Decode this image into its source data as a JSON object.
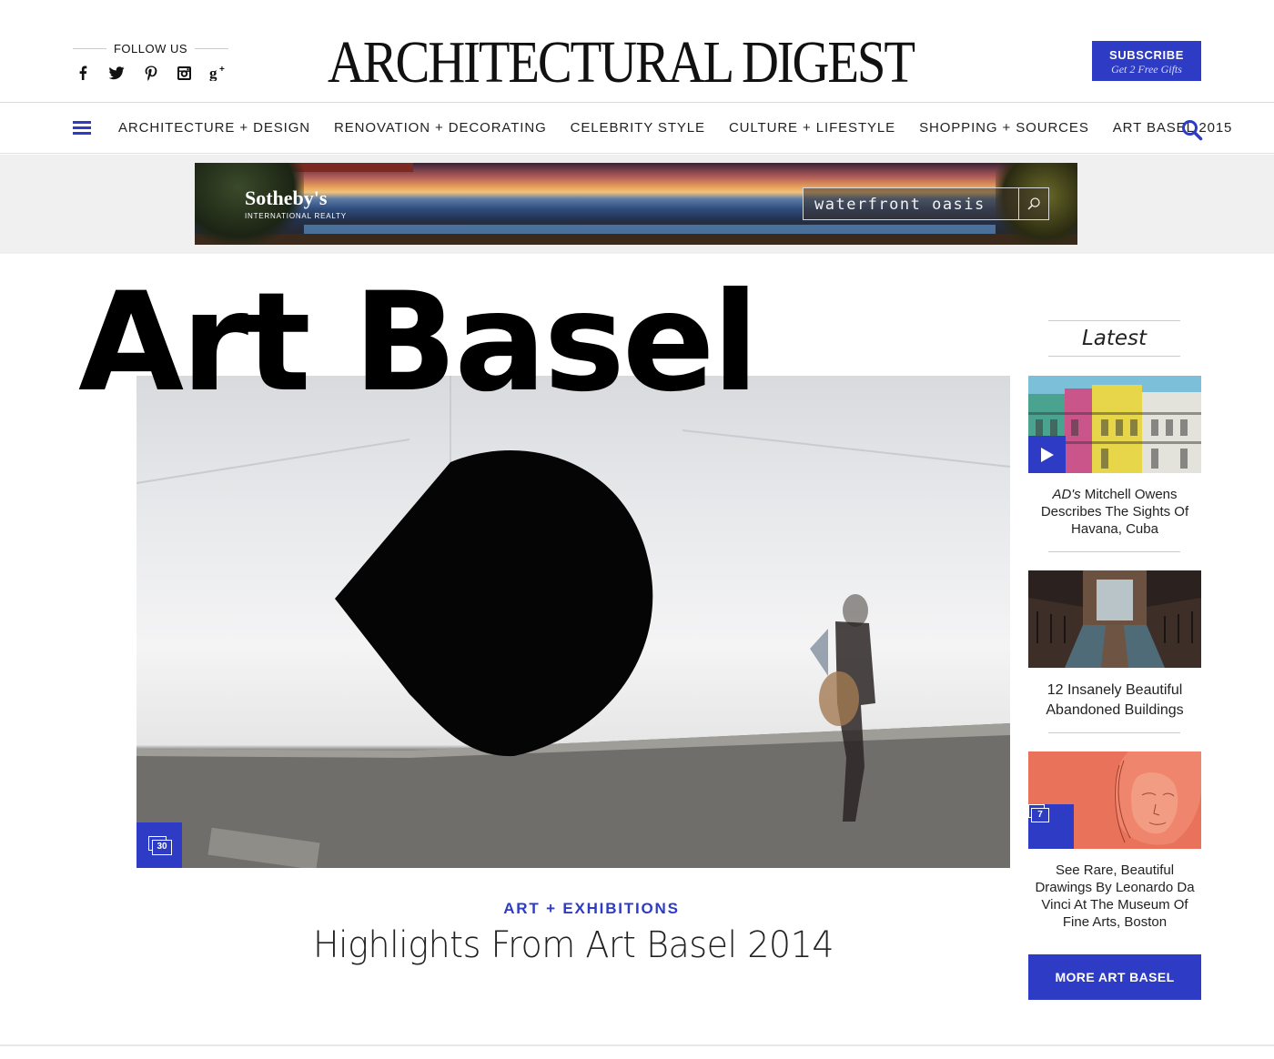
{
  "header": {
    "follow_label": "FOLLOW US",
    "social_icons": [
      "facebook-icon",
      "twitter-icon",
      "pinterest-icon",
      "instagram-icon",
      "google-plus-icon"
    ],
    "logo": "ARCHITECTURAL DIGEST",
    "subscribe": {
      "label": "SUBSCRIBE",
      "sublabel": "Get 2 Free Gifts"
    }
  },
  "nav": {
    "items": [
      "ARCHITECTURE + DESIGN",
      "RENOVATION + DECORATING",
      "CELEBRITY STYLE",
      "CULTURE + LIFESTYLE",
      "SHOPPING + SOURCES",
      "ART BASEL 2015"
    ]
  },
  "ad": {
    "brand": "Sotheby's",
    "brand_sub": "INTERNATIONAL REALTY",
    "search_value": "waterfront oasis"
  },
  "page_title": "Art Basel",
  "feature": {
    "gallery_count": "30",
    "kicker": "ART + EXHIBITIONS",
    "headline": "Highlights From Art Basel 2014"
  },
  "sidebar": {
    "heading": "Latest",
    "cards": [
      {
        "caption_em": "AD's",
        "caption": " Mitchell Owens Describes The Sights Of Havana, Cuba",
        "badge": "play-icon"
      },
      {
        "caption": "12 Insanely Beautiful Abandoned Buildings"
      },
      {
        "caption": "See Rare, Beautiful Drawings By Leonardo Da Vinci At The Museum Of Fine Arts, Boston",
        "gallery_count": "7"
      }
    ],
    "more_button": "MORE ART BASEL"
  },
  "colors": {
    "accent": "#2e3bc4",
    "text": "#111111",
    "rule": "#cccccc"
  }
}
